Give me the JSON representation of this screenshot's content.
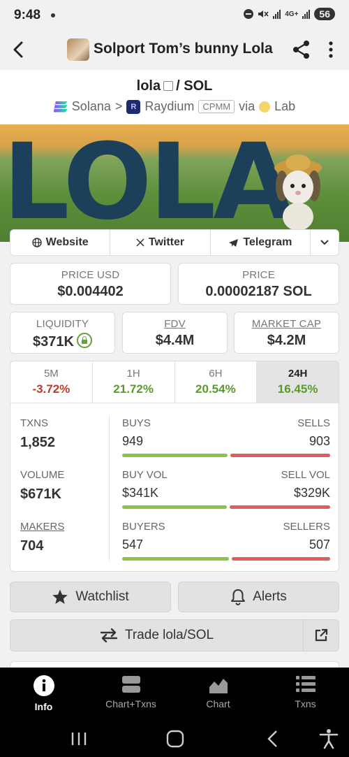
{
  "status_bar": {
    "time": "9:48",
    "network": "4G+",
    "battery": "56"
  },
  "header": {
    "title": "Solport Tom’s bunny Lola"
  },
  "pair": {
    "base": "lola",
    "quote": "/ SOL",
    "chain": "Solana",
    "separator": ">",
    "dex": "Raydium",
    "pool_type": "CPMM",
    "via": "via",
    "launchpad": "Lab"
  },
  "banner": {
    "text": "LOLA"
  },
  "links": [
    {
      "label": "Website",
      "icon": "globe-icon"
    },
    {
      "label": "Twitter",
      "icon": "x-icon"
    },
    {
      "label": "Telegram",
      "icon": "telegram-icon"
    }
  ],
  "prices": {
    "usd_label": "PRICE USD",
    "usd_value": "$0.004402",
    "native_label": "PRICE",
    "native_value": "0.00002187 SOL"
  },
  "metrics": {
    "liquidity_label": "LIQUIDITY",
    "liquidity_value": "$371K",
    "fdv_label": "FDV",
    "fdv_value": "$4.4M",
    "mcap_label": "MARKET CAP",
    "mcap_value": "$4.2M"
  },
  "timeframes": [
    {
      "label": "5M",
      "change": "-3.72%",
      "direction": "down"
    },
    {
      "label": "1H",
      "change": "21.72%",
      "direction": "up"
    },
    {
      "label": "6H",
      "change": "20.54%",
      "direction": "up"
    },
    {
      "label": "24H",
      "change": "16.45%",
      "direction": "up",
      "selected": true
    }
  ],
  "stats": {
    "txns_label": "TXNS",
    "txns_value": "1,852",
    "buys_label": "BUYS",
    "buys_value": "949",
    "sells_label": "SELLS",
    "sells_value": "903",
    "buys_share": 0.512,
    "volume_label": "VOLUME",
    "volume_value": "$671K",
    "buyvol_label": "BUY VOL",
    "buyvol_value": "$341K",
    "sellvol_label": "SELL VOL",
    "sellvol_value": "$329K",
    "buyvol_share": 0.509,
    "makers_label": "MAKERS",
    "makers_value": "704",
    "buyers_label": "BUYERS",
    "buyers_value": "547",
    "sellers_label": "SELLERS",
    "sellers_value": "507",
    "buyers_share": 0.519
  },
  "actions": {
    "watchlist": "Watchlist",
    "alerts": "Alerts",
    "trade": "Trade lola/SOL"
  },
  "bottom_nav": [
    {
      "label": "Info",
      "icon": "info-icon",
      "active": true
    },
    {
      "label": "Chart+Txns",
      "icon": "chart-txns-icon"
    },
    {
      "label": "Chart",
      "icon": "chart-icon"
    },
    {
      "label": "Txns",
      "icon": "list-icon"
    }
  ],
  "colors": {
    "negative": "#c0392b",
    "positive": "#5a9a2a",
    "buy_bar": "#8bc34a",
    "sell_bar": "#e05d5d"
  }
}
